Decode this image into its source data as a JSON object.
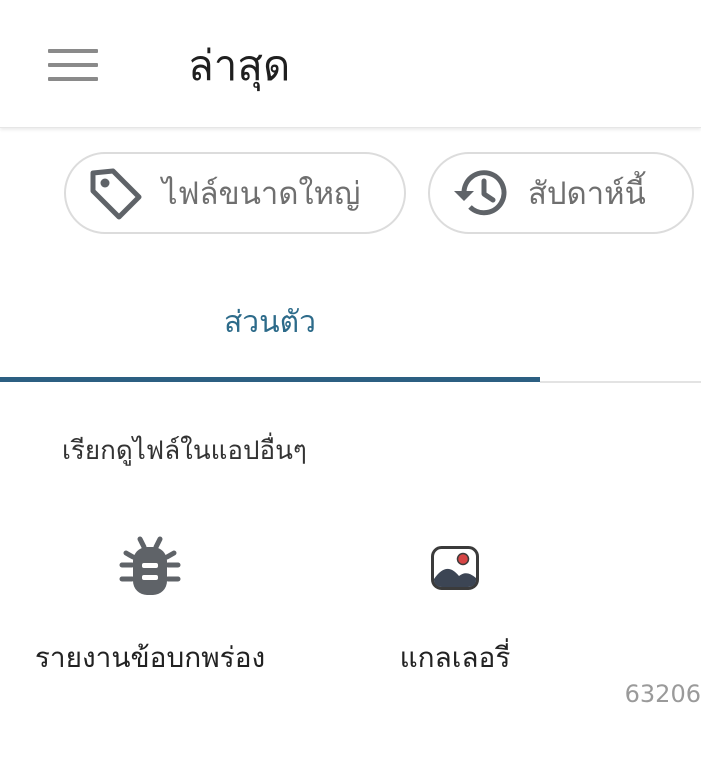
{
  "header": {
    "title": "ล่าสุด",
    "menu_icon": "hamburger-menu-icon"
  },
  "chips": [
    {
      "label": "ไฟล์ขนาดใหญ่",
      "icon": "tag-icon"
    },
    {
      "label": "สัปดาห์นี้",
      "icon": "history-icon"
    }
  ],
  "tabs": [
    {
      "label": "ส่วนตัว",
      "selected": true
    }
  ],
  "section": {
    "header": "เรียกดูไฟล์ในแอปอื่นๆ"
  },
  "apps": [
    {
      "label": "รายงานข้อบกพร่อง",
      "icon": "bug-icon"
    },
    {
      "label": "แกลเลอรี่",
      "icon": "gallery-icon"
    }
  ],
  "footer": {
    "build": "63206"
  },
  "colors": {
    "accent": "#2c5f82",
    "tab_text": "#2d6b8a",
    "chip_border": "#dcdcdc",
    "muted_text": "#6f6f6f"
  }
}
